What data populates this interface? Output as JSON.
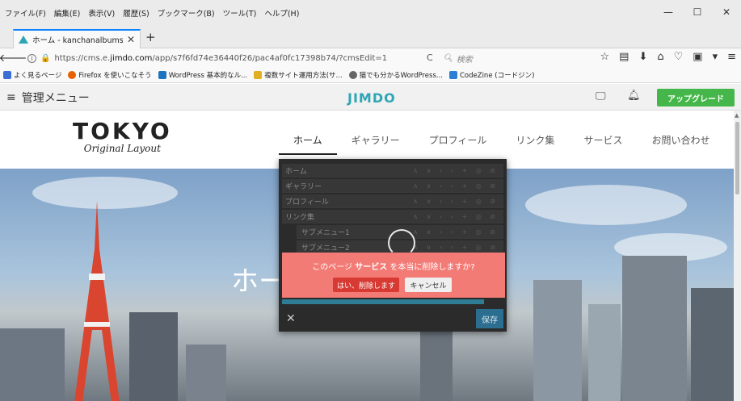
{
  "browser": {
    "menus": [
      "ファイル(F)",
      "編集(E)",
      "表示(V)",
      "履歴(S)",
      "ブックマーク(B)",
      "ツール(T)",
      "ヘルプ(H)"
    ],
    "window_controls": {
      "minimize": "—",
      "maximize": "☐",
      "close": "✕"
    },
    "tab": {
      "title": "ホーム - kanchanalbumsite べ",
      "close": "✕"
    },
    "new_tab": "+",
    "url": {
      "prefix": "https://cms.e.",
      "domain": "jimdo.com",
      "path": "/app/s7f6fd74e36440f26/pac4af0fc17398b74/?cmsEdit=1"
    },
    "search_placeholder": "検索",
    "bookmarks": [
      {
        "label": "よく見るページ",
        "color": "#3b6fd4"
      },
      {
        "label": "Firefox を使いこなそう",
        "color": "#e66000"
      },
      {
        "label": "WordPress 基本的なル...",
        "color": "#1e73be"
      },
      {
        "label": "複数サイト運用方法(サ...",
        "color": "#e0b020"
      },
      {
        "label": "猫でも分かるWordPress...",
        "color": "#666666"
      },
      {
        "label": "CodeZine (コードジン)",
        "color": "#2a7fd4"
      }
    ]
  },
  "jimdo_bar": {
    "menu_label": "管理メニュー",
    "logo": "JIMDO",
    "upgrade_label": "アップグレード",
    "upgrade_color": "#45b649"
  },
  "site": {
    "logo_main": "TOKYO",
    "logo_sub": "Original Layout",
    "nav": [
      "ホーム",
      "ギャラリー",
      "プロフィール",
      "リンク集",
      "サービス",
      "お問い合わせ"
    ],
    "hero_title": "ホー"
  },
  "nav_editor": {
    "items": [
      {
        "label": "ホーム",
        "level": 0
      },
      {
        "label": "ギャラリー",
        "level": 0
      },
      {
        "label": "プロフィール",
        "level": 0
      },
      {
        "label": "リンク集",
        "level": 0
      },
      {
        "label": "サブメニュー1",
        "level": 1
      },
      {
        "label": "サブメニュー2",
        "level": 1
      }
    ],
    "row_controls": "∧ ∨ ‹ › + ◎ ⊘",
    "close_label": "✕",
    "save_label": "保存",
    "save_color": "#2c6e90"
  },
  "confirm_dialog": {
    "prefix": "このページ ",
    "page_name": "サービス",
    "suffix": " を本当に削除しますか?",
    "yes_label": "はい、削除します",
    "cancel_label": "キャンセル",
    "background": "#f37b76"
  }
}
